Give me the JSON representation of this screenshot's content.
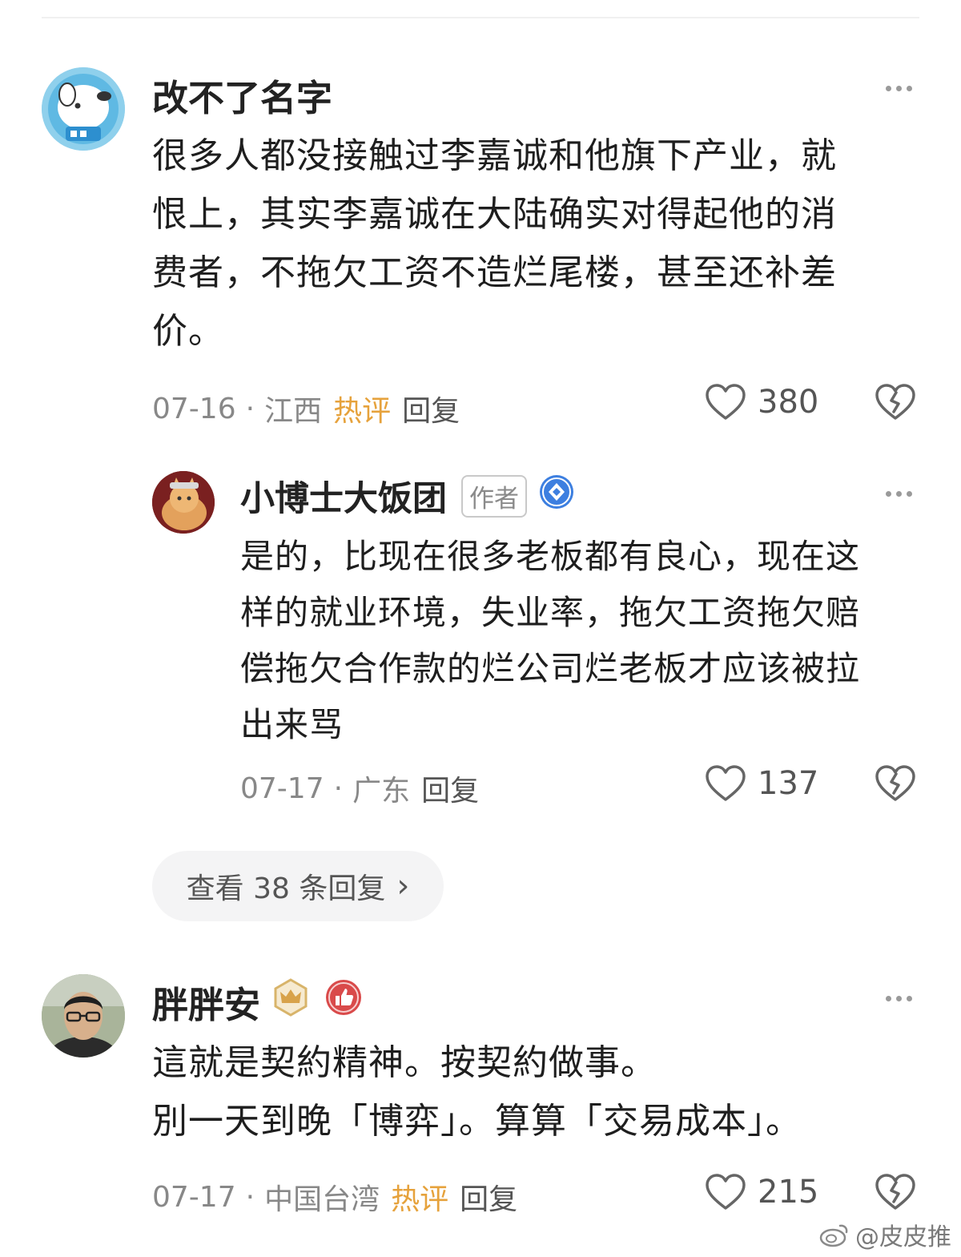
{
  "comments": [
    {
      "name": "改不了名字",
      "lines": [
        "很多人都没接触过李嘉诚和他旗下产业，就",
        "恨上，其实李嘉诚在大陆确实对得起他的消",
        "费者，不拖欠工资不造烂尾楼，甚至还补差",
        "价。"
      ],
      "date": "07-16",
      "location": "江西",
      "hot": "热评",
      "reply": "回复",
      "likes": "380"
    },
    {
      "name": "小博士大饭团",
      "badge": "作者",
      "lines": [
        "是的，比现在很多老板都有良心，现在这",
        "样的就业环境，失业率，拖欠工资拖欠赔",
        "偿拖欠合作款的烂公司烂老板才应该被拉",
        "出来骂"
      ],
      "date": "07-17",
      "location": "广东",
      "reply": "回复",
      "likes": "137"
    },
    {
      "name": "胖胖安",
      "lines": [
        "這就是契約精神。按契約做事。",
        "別一天到晚「博弈」。算算「交易成本」。"
      ],
      "date": "07-17",
      "location": "中国台湾",
      "hot": "热评",
      "reply": "回复",
      "likes": "215"
    }
  ],
  "separator": "·",
  "view_replies": {
    "label": "查看 38 条回复",
    "chevron": "›"
  },
  "watermark": {
    "text": "@皮皮推",
    "icon": "weibo-icon"
  },
  "colors": {
    "hot": "#e6a23c",
    "meta": "#888888",
    "text": "#1e1e1e"
  }
}
